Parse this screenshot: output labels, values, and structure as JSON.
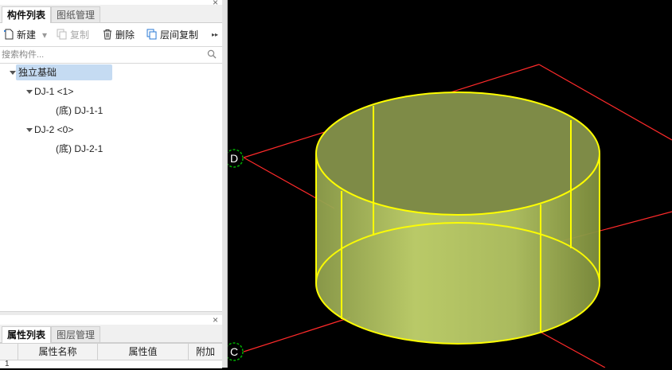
{
  "top_panel": {
    "tabs": [
      {
        "label": "构件列表",
        "active": true
      },
      {
        "label": "图纸管理",
        "active": false
      }
    ],
    "close_glyph": "×"
  },
  "toolbar": {
    "new_label": "新建",
    "copy_label": "复制",
    "delete_label": "删除",
    "floor_copy_label": "层间复制",
    "more_glyph": "▸▸"
  },
  "search": {
    "placeholder": "搜索构件..."
  },
  "tree": {
    "root": "独立基础",
    "items": [
      {
        "label": "DJ-1 <1>",
        "child": "(底) DJ-1-1"
      },
      {
        "label": "DJ-2 <0>",
        "child": "(底) DJ-2-1"
      }
    ]
  },
  "bottom_panel": {
    "tabs": [
      {
        "label": "属性列表",
        "active": true
      },
      {
        "label": "图层管理",
        "active": false
      }
    ],
    "close_glyph": "×",
    "columns": [
      "属性名称",
      "属性值",
      "附加"
    ],
    "first_row_index": "1"
  },
  "viewport": {
    "axis_labels": [
      "D",
      "C"
    ],
    "colors": {
      "background": "#000000",
      "grid": "#ff0000",
      "outline": "#ffff00",
      "fill": "#b7c96a",
      "axis_circle": "#00a000"
    }
  }
}
